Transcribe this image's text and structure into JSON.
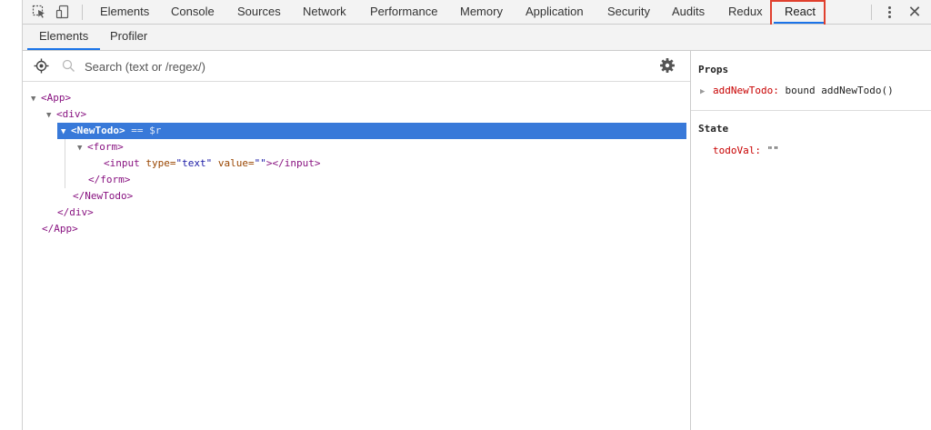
{
  "toolbar": {
    "inspect_icon": "cursor-select-icon",
    "device_icon": "device-toggle-icon",
    "tabs": [
      "Elements",
      "Console",
      "Sources",
      "Network",
      "Performance",
      "Memory",
      "Application",
      "Security",
      "Audits",
      "Redux",
      "React"
    ],
    "active_tab": "React",
    "more_icon": "vertical-dots-icon",
    "close_label": "✕"
  },
  "subtabs": {
    "items": [
      "Elements",
      "Profiler"
    ],
    "active": "Elements"
  },
  "search": {
    "placeholder": "Search (text or /regex/)",
    "value": ""
  },
  "tree": {
    "app_open": "<App>",
    "div_open": "<div>",
    "newtodo_open": "<NewTodo>",
    "sel_suffix": "== $r",
    "form_open": "<form>",
    "input_tag_start": "<input",
    "input_attr_type": "type",
    "input_type_val": "\"text\"",
    "input_attr_value": "value",
    "input_value_val": "\"\"",
    "input_tag_end": "></input>",
    "form_close": "</form>",
    "newtodo_close": "</NewTodo>",
    "div_close": "</div>",
    "app_close": "</App>"
  },
  "side": {
    "props_title": "Props",
    "prop_key": "addNewTodo:",
    "prop_val": "bound addNewTodo()",
    "state_title": "State",
    "state_key": "todoVal:",
    "state_val": "\"\""
  },
  "colors": {
    "accent": "#1a73e8",
    "selection": "#3879d9",
    "highlight_box": "#e0402e",
    "tag": "#881280",
    "attr": "#994500",
    "attr_value": "#1a1aa6",
    "prop_key": "#c80000"
  }
}
